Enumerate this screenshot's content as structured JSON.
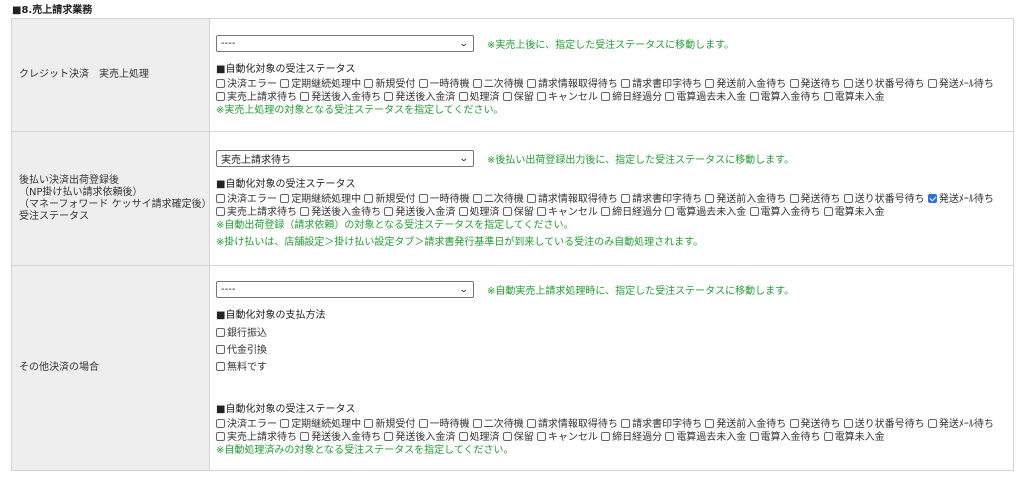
{
  "section_title": "■8.売上請求業務",
  "status_options": [
    "決済エラー",
    "定期継続処理中",
    "新規受付",
    "一時待機",
    "二次待機",
    "請求情報取得待ち",
    "請求書印字待ち",
    "発送前入金待ち",
    "発送待ち",
    "送り状番号待ち",
    "発送ﾒｰﾙ待ち",
    "実売上請求待ち",
    "発送後入金待ち",
    "発送後入金済",
    "処理済",
    "保留",
    "キャンセル",
    "締日経過分",
    "電算過去未入金",
    "電算入金待ち",
    "電算未入金"
  ],
  "rows": [
    {
      "label_lines": [
        "クレジット決済　実売上処理"
      ],
      "select_value": "----",
      "select_note": "※実売上後に、指定した受注ステータスに移動します。",
      "group_title": "■自動化対象の受注ステータス",
      "checked": [],
      "notes": [
        "※実売上処理の対象となる受注ステータスを指定してください。"
      ]
    },
    {
      "label_lines": [
        "後払い決済出荷登録後",
        "（NP掛け払い請求依頼後）",
        "（マネーフォワード ケッサイ請求確定後）",
        "受注ステータス"
      ],
      "select_value": "実売上請求待ち",
      "select_note": "※後払い出荷登録出力後に、指定した受注ステータスに移動します。",
      "group_title": "■自動化対象の受注ステータス",
      "checked": [
        "発送ﾒｰﾙ待ち"
      ],
      "notes": [
        "※自動出荷登録（請求依頼）の対象となる受注ステータスを指定してください。",
        "※掛け払いは、店舗設定＞掛け払い設定タブ＞請求書発行基準日が到来している受注のみ自動処理されます。"
      ]
    },
    {
      "label_lines": [
        "その他決済の場合"
      ],
      "select_value": "----",
      "select_note": "※自動実売上請求処理時に、指定した受注ステータスに移動します。",
      "payment_group_title": "■自動化対象の支払方法",
      "payment_methods": [
        "銀行振込",
        "代金引換",
        "無料です"
      ],
      "group_title": "■自動化対象の受注ステータス",
      "checked": [],
      "notes": [
        "※自動処理済みの対象となる受注ステータスを指定してください。"
      ]
    }
  ]
}
